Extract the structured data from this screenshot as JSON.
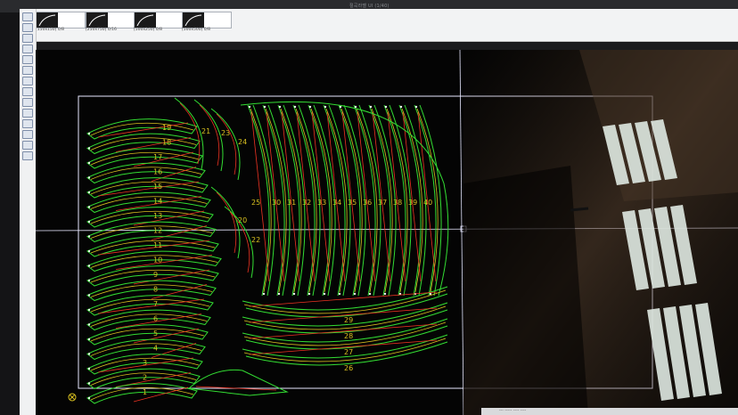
{
  "window": {
    "title": "절곡라벨 UI (1/40)"
  },
  "toolbar": {
    "thumbnails": [
      {
        "label": "[150x150] 0/8"
      },
      {
        "label": "[250x750] 0/16"
      },
      {
        "label": "[500x250] 0/8"
      },
      {
        "label": "[500x500] 0/8"
      }
    ]
  },
  "canvas": {
    "background": "#040404",
    "part_color": "#33dd33",
    "cut_color": "#ee3322",
    "path_color": "#d8c020",
    "sheet_color": "#e8e8ff",
    "part_labels": {
      "left_stack": [
        "19",
        "18",
        "17",
        "16",
        "15",
        "14",
        "13",
        "12",
        "11",
        "10",
        "9",
        "8",
        "7",
        "6",
        "5",
        "4",
        "3",
        "2",
        "1"
      ],
      "middle": [
        "21",
        "23",
        "24",
        "20",
        "22"
      ],
      "right_fan": [
        "25",
        "30",
        "31",
        "32",
        "33",
        "34",
        "35",
        "36",
        "37",
        "38",
        "39",
        "40"
      ],
      "bottom_right": [
        "29",
        "28",
        "27",
        "26"
      ]
    }
  },
  "status": {
    "text": "--- ----- ---- ----"
  }
}
